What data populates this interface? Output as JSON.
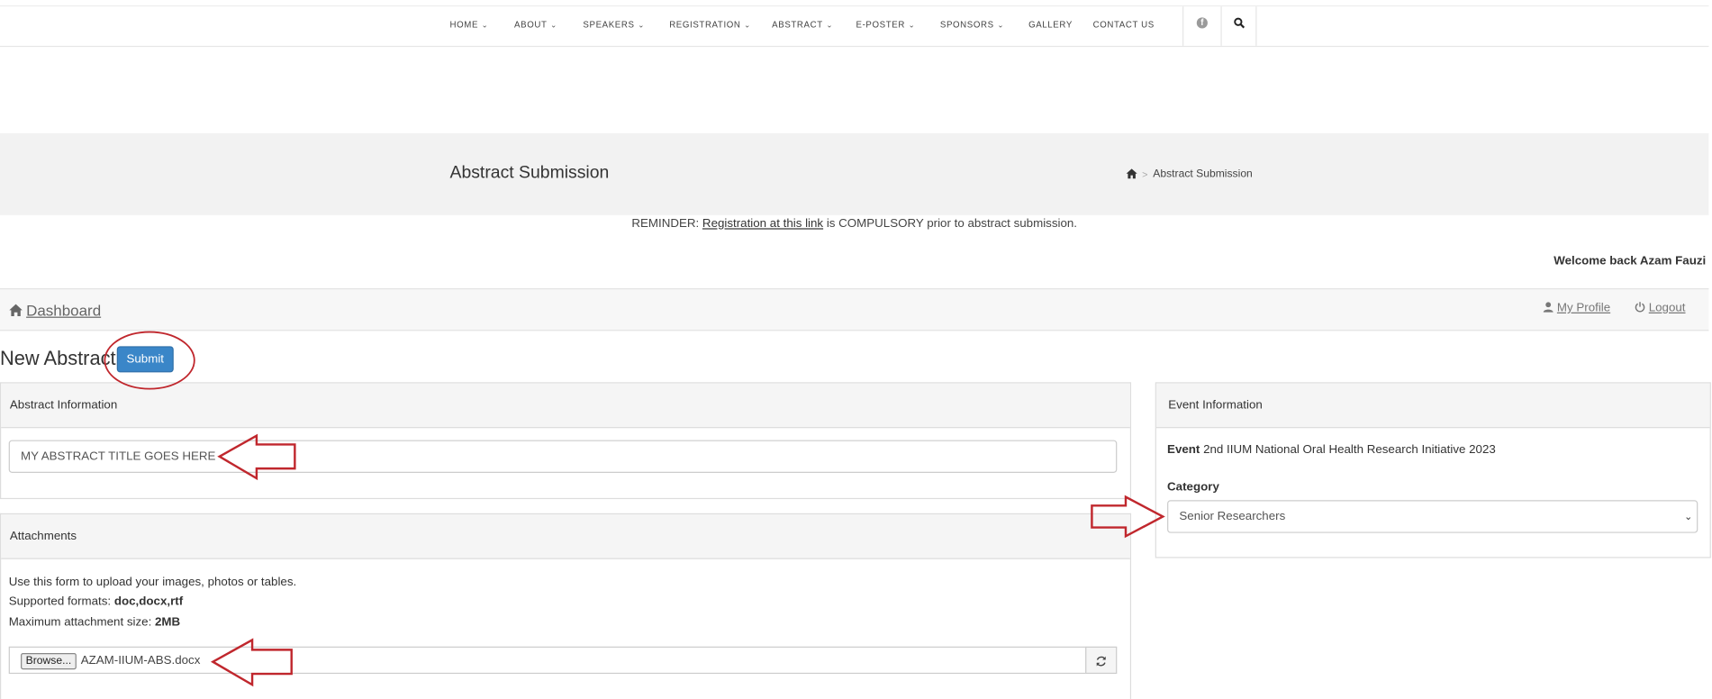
{
  "nav": {
    "items": [
      {
        "label": "HOME",
        "dropdown": true
      },
      {
        "label": "ABOUT",
        "dropdown": true
      },
      {
        "label": "SPEAKERS",
        "dropdown": true
      },
      {
        "label": "REGISTRATION",
        "dropdown": true
      },
      {
        "label": "ABSTRACT",
        "dropdown": true
      },
      {
        "label": "E-POSTER",
        "dropdown": true
      },
      {
        "label": "SPONSORS",
        "dropdown": true
      },
      {
        "label": "GALLERY",
        "dropdown": false
      },
      {
        "label": "CONTACT US",
        "dropdown": false
      }
    ],
    "chevron": "⌄",
    "icons": [
      "facebook-icon",
      "search-icon"
    ]
  },
  "header": {
    "page_title": "Abstract Submission",
    "breadcrumb": "Abstract Submission",
    "breadcrumb_sep": ">"
  },
  "reminder": {
    "prefix": "REMINDER: ",
    "link": "Registration at this link",
    "suffix": " is COMPULSORY prior to abstract submission."
  },
  "user": {
    "welcome": "Welcome back Azam Fauzi"
  },
  "dashbar": {
    "dashboard": "Dashboard",
    "my_profile": "My Profile",
    "logout": "Logout"
  },
  "form": {
    "title": "New Abstract",
    "submit": "Submit",
    "abstract_panel": "Abstract Information",
    "abstract_title_value": "MY ABSTRACT TITLE GOES HERE",
    "attachments_panel": "Attachments",
    "attach_line1": "Use this form to upload your images, photos or tables.",
    "attach_formats_label": "Supported formats: ",
    "attach_formats": "doc,docx,rtf",
    "attach_size_label": "Maximum attachment size: ",
    "attach_size": "2MB",
    "browse": "Browse...",
    "file_name": "AZAM-IIUM-ABS.docx"
  },
  "event": {
    "panel": "Event Information",
    "event_label": "Event",
    "event_value": "2nd IIUM National Oral Health Research Initiative 2023",
    "category_label": "Category",
    "category_value": "Senior Researchers"
  },
  "colors": {
    "submit_bg": "#3a86c8",
    "annotation": "#c0272d",
    "band": "#f2f2f2"
  }
}
